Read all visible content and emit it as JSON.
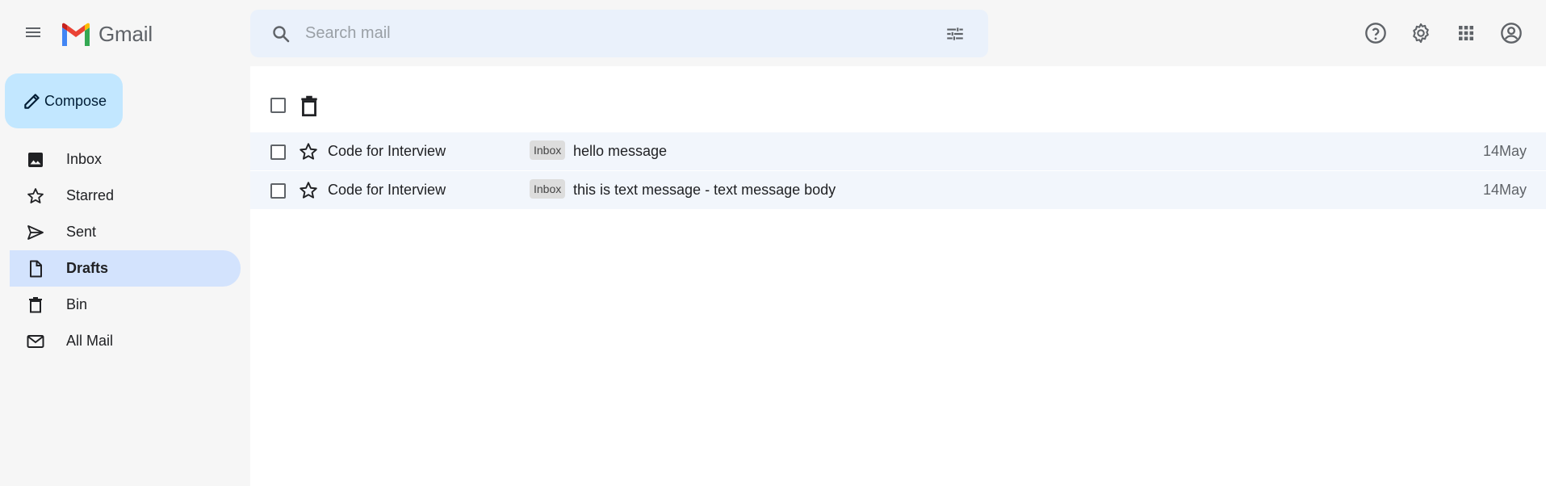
{
  "app": {
    "name": "Gmail",
    "search_placeholder": "Search mail"
  },
  "header_icons": [
    "help-icon",
    "settings-gear-icon",
    "apps-grid-icon",
    "account-icon"
  ],
  "sidebar": {
    "compose_label": "Compose",
    "items": [
      {
        "label": "Inbox",
        "icon": "image-icon",
        "active": false
      },
      {
        "label": "Starred",
        "icon": "star-icon",
        "active": false
      },
      {
        "label": "Sent",
        "icon": "send-icon",
        "active": false
      },
      {
        "label": "Drafts",
        "icon": "draft-icon",
        "active": true
      },
      {
        "label": "Bin",
        "icon": "trash-icon",
        "active": false
      },
      {
        "label": "All Mail",
        "icon": "mail-icon",
        "active": false
      }
    ]
  },
  "emails": [
    {
      "sender": "Code for Interview",
      "label": "Inbox",
      "subject": "hello message",
      "date": "14May"
    },
    {
      "sender": "Code for Interview",
      "label": "Inbox",
      "subject": "this is text message - text message body",
      "date": "14May"
    }
  ],
  "colors": {
    "compose_bg": "#c2e7ff",
    "active_nav_bg": "#d3e3fd",
    "search_bg": "#eaf1fb",
    "row_bg": "#f2f6fc"
  }
}
